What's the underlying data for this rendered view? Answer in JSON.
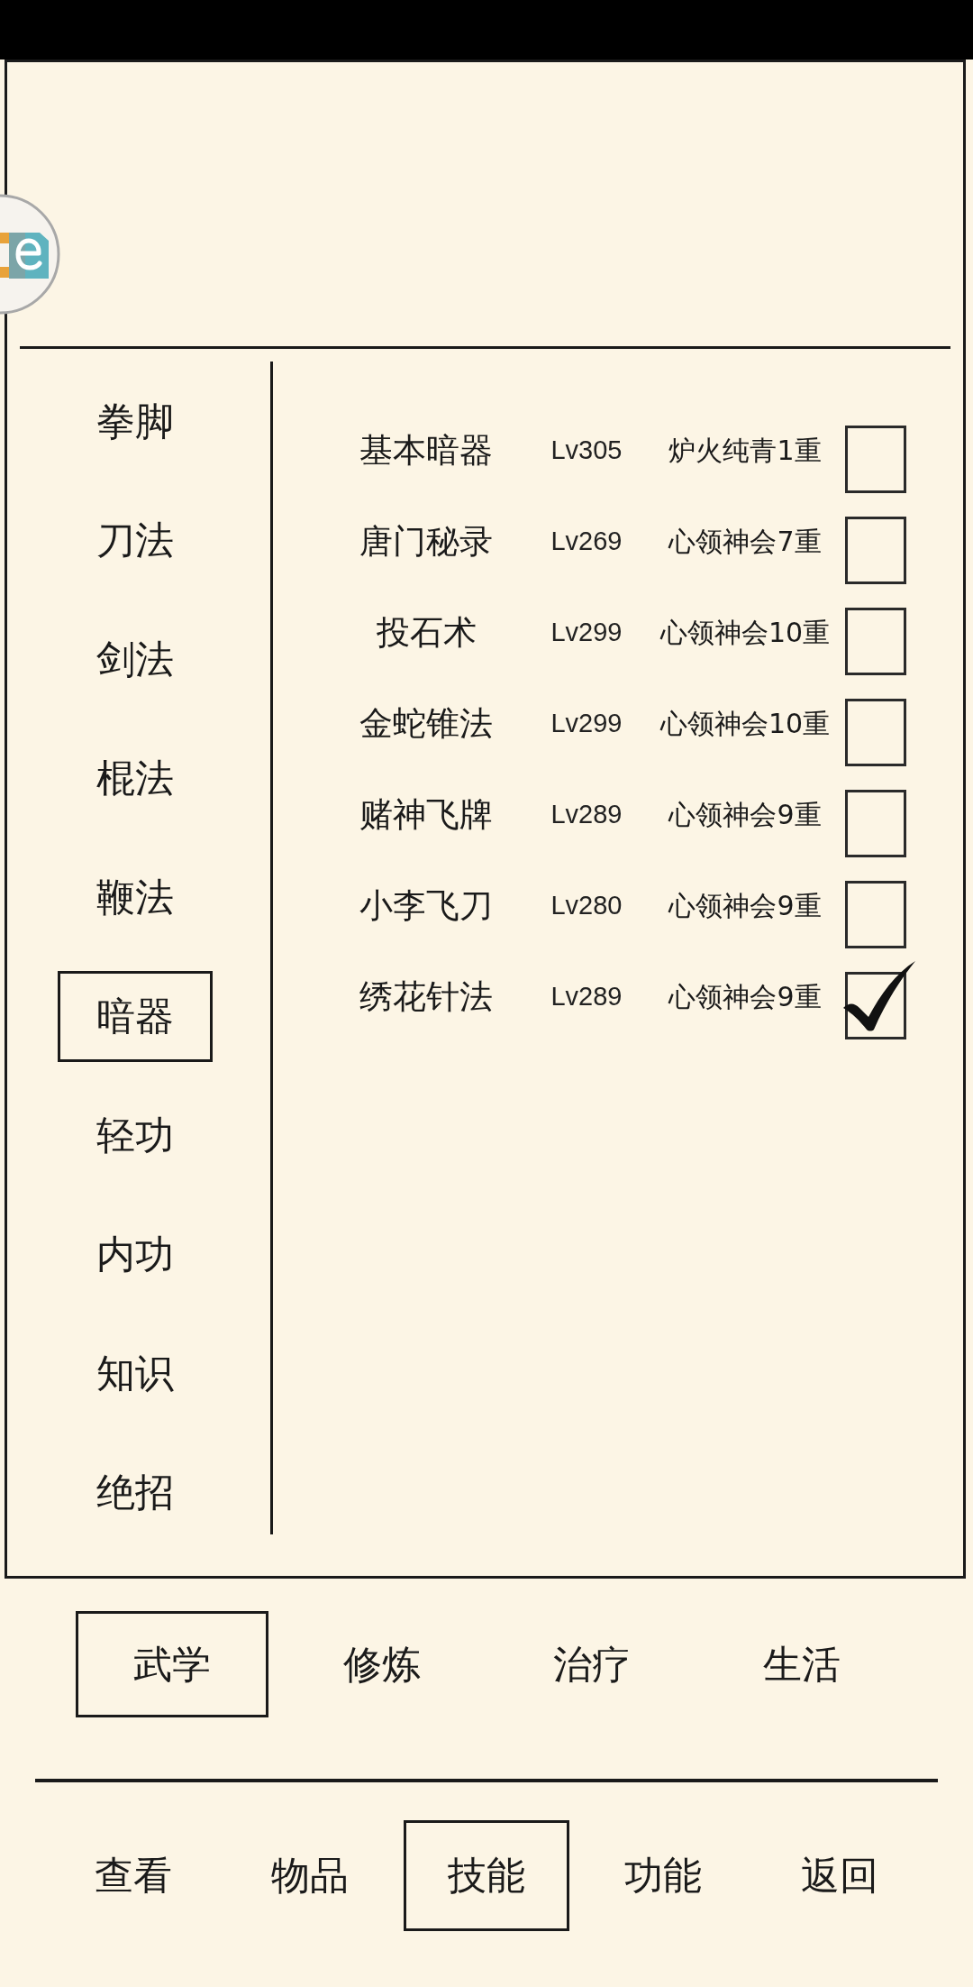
{
  "sidebar": {
    "items": [
      {
        "label": "拳脚",
        "selected": false
      },
      {
        "label": "刀法",
        "selected": false
      },
      {
        "label": "剑法",
        "selected": false
      },
      {
        "label": "棍法",
        "selected": false
      },
      {
        "label": "鞭法",
        "selected": false
      },
      {
        "label": "暗器",
        "selected": true
      },
      {
        "label": "轻功",
        "selected": false
      },
      {
        "label": "内功",
        "selected": false
      },
      {
        "label": "知识",
        "selected": false
      },
      {
        "label": "绝招",
        "selected": false
      }
    ]
  },
  "skills": [
    {
      "name": "基本暗器",
      "level_text": "Lv305",
      "realm": "炉火纯青1重",
      "checked": false
    },
    {
      "name": "唐门秘录",
      "level_text": "Lv269",
      "realm": "心领神会7重",
      "checked": false
    },
    {
      "name": "投石术",
      "level_text": "Lv299",
      "realm": "心领神会10重",
      "checked": false
    },
    {
      "name": "金蛇锥法",
      "level_text": "Lv299",
      "realm": "心领神会10重",
      "checked": false
    },
    {
      "name": "赌神飞牌",
      "level_text": "Lv289",
      "realm": "心领神会9重",
      "checked": false
    },
    {
      "name": "小李飞刀",
      "level_text": "Lv280",
      "realm": "心领神会9重",
      "checked": false
    },
    {
      "name": "绣花针法",
      "level_text": "Lv289",
      "realm": "心领神会9重",
      "checked": true
    }
  ],
  "category_tabs": [
    {
      "label": "武学",
      "selected": true
    },
    {
      "label": "修炼",
      "selected": false
    },
    {
      "label": "治疗",
      "selected": false
    },
    {
      "label": "生活",
      "selected": false
    }
  ],
  "bottom_nav": [
    {
      "label": "查看",
      "selected": false
    },
    {
      "label": "物品",
      "selected": false
    },
    {
      "label": "技能",
      "selected": true
    },
    {
      "label": "功能",
      "selected": false
    },
    {
      "label": "返回",
      "selected": false
    }
  ]
}
